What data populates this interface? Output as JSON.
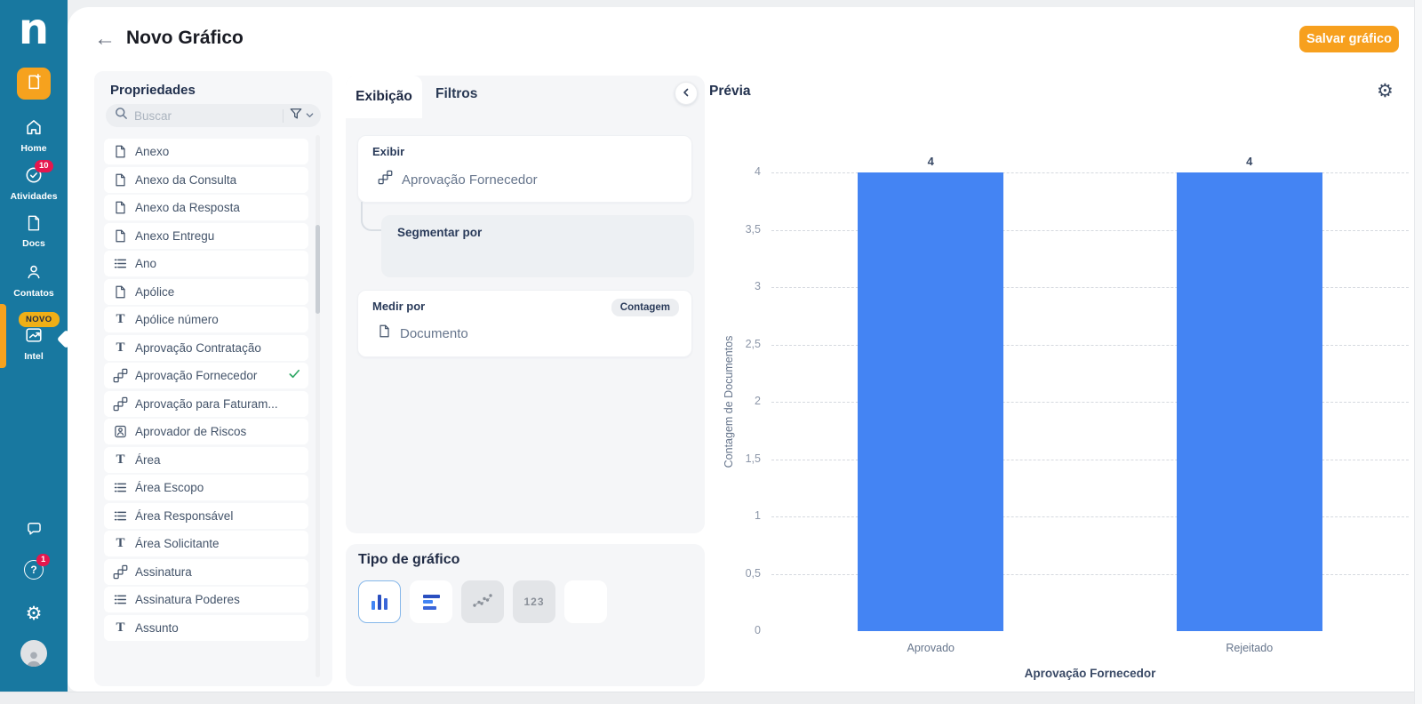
{
  "header": {
    "title": "Novo Gráfico",
    "save_label": "Salvar gráfico"
  },
  "sidebar": {
    "logo": "n",
    "items": [
      {
        "label": "Home",
        "icon": "home-icon"
      },
      {
        "label": "Atividades",
        "icon": "activities-icon",
        "badge": "10"
      },
      {
        "label": "Docs",
        "icon": "docs-icon"
      },
      {
        "label": "Contatos",
        "icon": "contacts-icon"
      },
      {
        "label": "Intel",
        "icon": "intel-icon",
        "badge_text": "NOVO",
        "selected": true
      }
    ],
    "bottom": [
      {
        "icon": "chat-icon"
      },
      {
        "icon": "help-icon",
        "badge": "1",
        "glyph": "?"
      },
      {
        "icon": "settings-icon",
        "glyph": "⚙"
      },
      {
        "icon": "avatar"
      }
    ]
  },
  "properties": {
    "title": "Propriedades",
    "search_placeholder": "Buscar",
    "items": [
      {
        "label": "Anexo",
        "icon": "doc-icon"
      },
      {
        "label": "Anexo da Consulta",
        "icon": "doc-icon"
      },
      {
        "label": "Anexo da Resposta",
        "icon": "doc-icon"
      },
      {
        "label": "Anexo Entregu",
        "icon": "doc-icon"
      },
      {
        "label": "Ano",
        "icon": "list-icon"
      },
      {
        "label": "Apólice",
        "icon": "doc-icon"
      },
      {
        "label": "Apólice número",
        "icon": "text-icon"
      },
      {
        "label": "Aprovação Contratação",
        "icon": "text-icon"
      },
      {
        "label": "Aprovação Fornecedor",
        "icon": "workflow-icon",
        "selected": true
      },
      {
        "label": "Aprovação para Faturam...",
        "icon": "workflow-icon"
      },
      {
        "label": "Aprovador de Riscos",
        "icon": "person-doc-icon"
      },
      {
        "label": "Área",
        "icon": "text-icon"
      },
      {
        "label": "Área Escopo",
        "icon": "list-icon"
      },
      {
        "label": "Área Responsável",
        "icon": "list-icon"
      },
      {
        "label": "Área Solicitante",
        "icon": "text-icon"
      },
      {
        "label": "Assinatura",
        "icon": "workflow-icon"
      },
      {
        "label": "Assinatura Poderes",
        "icon": "list-icon"
      },
      {
        "label": "Assunto",
        "icon": "text-icon"
      }
    ]
  },
  "builder": {
    "tabs": [
      {
        "label": "Exibição",
        "active": true
      },
      {
        "label": "Filtros",
        "active": false
      }
    ],
    "exibir": {
      "label": "Exibir",
      "value": "Aprovação Fornecedor",
      "icon": "workflow-icon"
    },
    "segmentar": {
      "label": "Segmentar por"
    },
    "medir": {
      "label": "Medir por",
      "badge": "Contagem",
      "value": "Documento",
      "icon": "doc-icon"
    },
    "chart_type": {
      "title": "Tipo de gráfico",
      "options": [
        {
          "name": "bar",
          "selected": true,
          "disabled": false
        },
        {
          "name": "horizontal-bar",
          "selected": false,
          "disabled": false
        },
        {
          "name": "scatter",
          "selected": false,
          "disabled": true
        },
        {
          "name": "number",
          "label": "123",
          "selected": false,
          "disabled": true
        },
        {
          "name": "pie",
          "selected": false,
          "disabled": false
        }
      ]
    }
  },
  "preview": {
    "title": "Prévia"
  },
  "chart_data": {
    "type": "bar",
    "categories": [
      "Aprovado",
      "Rejeitado"
    ],
    "values": [
      4,
      4
    ],
    "value_labels": [
      "4",
      "4"
    ],
    "title": "",
    "xlabel": "Aprovação Fornecedor",
    "ylabel": "Contagem de Documentos",
    "ylim": [
      0,
      4
    ],
    "ytick_step": 0.5,
    "ytick_labels": [
      "0",
      "0,5",
      "1",
      "1,5",
      "2",
      "2,5",
      "3",
      "3,5",
      "4"
    ],
    "bar_color": "#4484F3",
    "grid": "dashed",
    "legend": "none"
  }
}
